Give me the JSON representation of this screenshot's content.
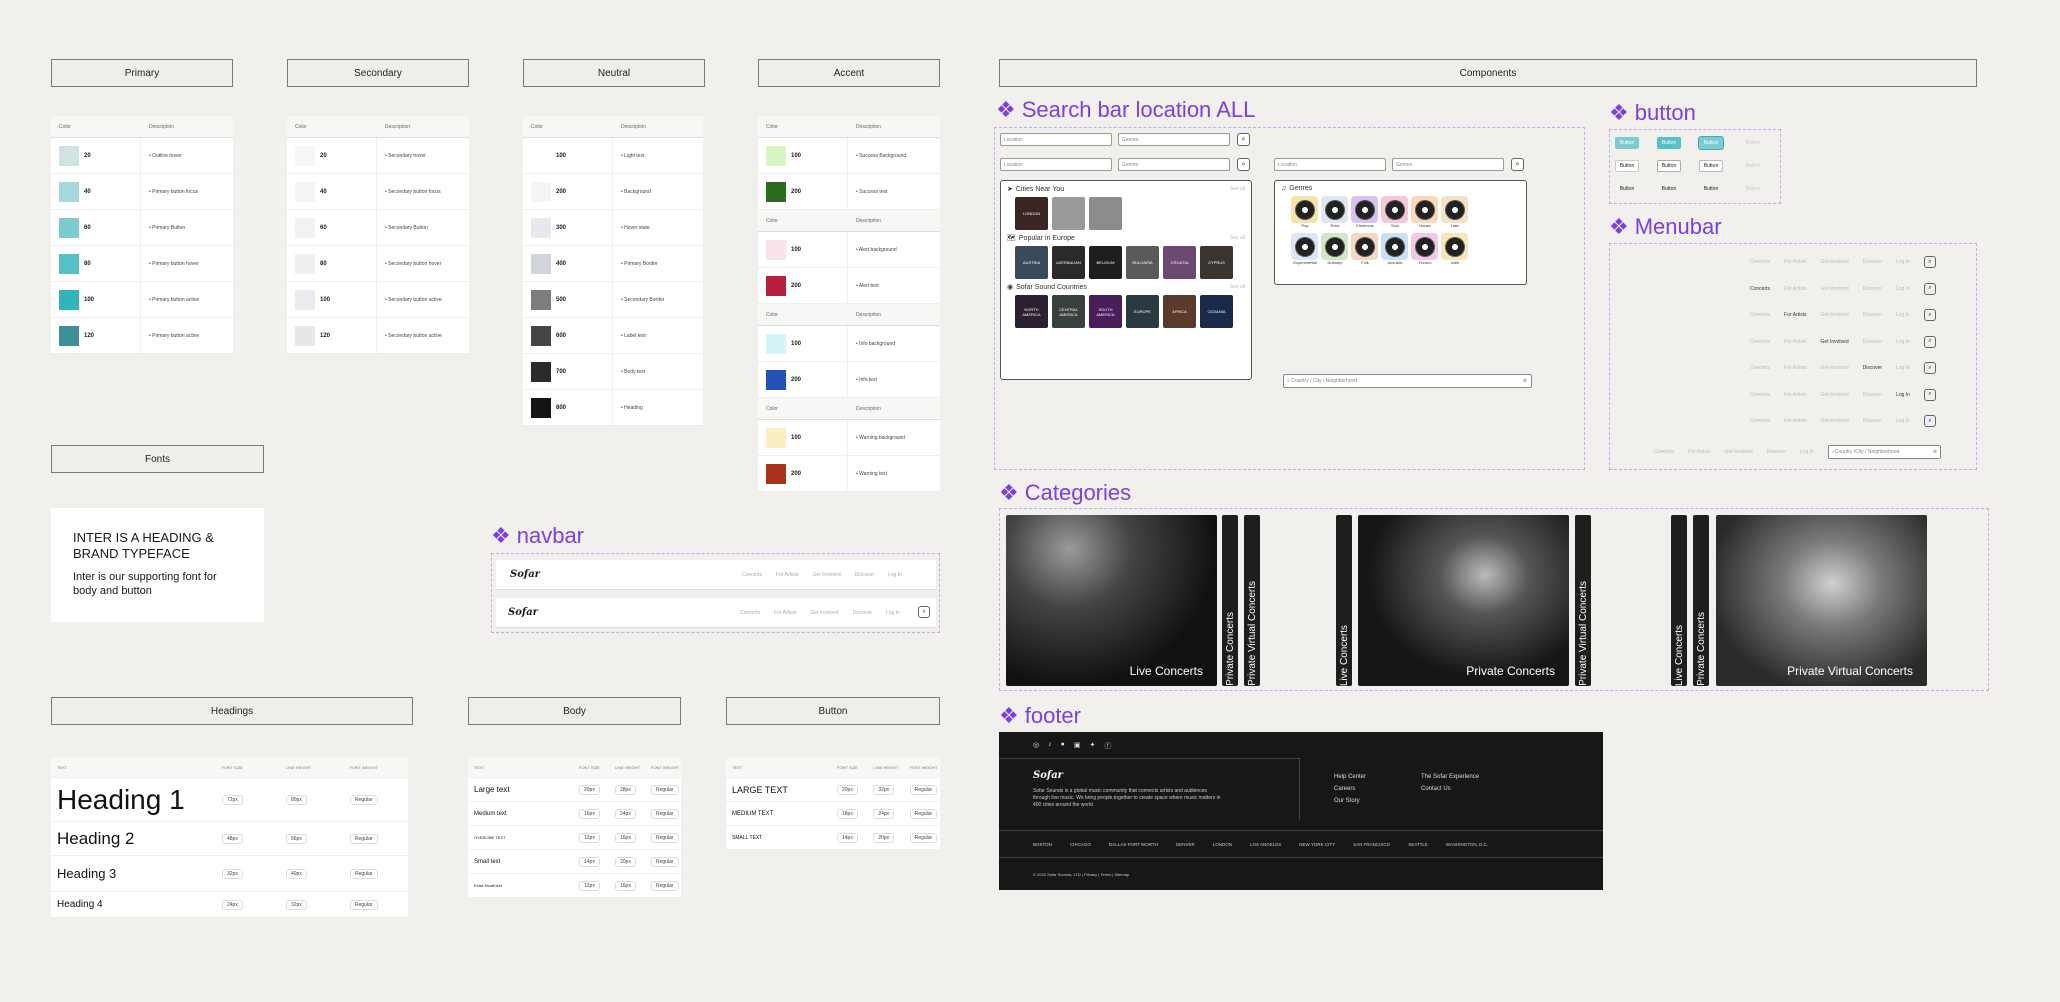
{
  "frames": {
    "primary": "Primary",
    "secondary": "Secondary",
    "neutral": "Neutral",
    "accent": "Accent",
    "components": "Components",
    "fonts": "Fonts",
    "headings": "Headings",
    "body": "Body",
    "button": "Button"
  },
  "table_header": {
    "color": "Color",
    "description": "Description"
  },
  "primary_rows": [
    {
      "w": "20",
      "d": "• Outline hover",
      "c": "#cfe3e3"
    },
    {
      "w": "40",
      "d": "• Primary button focus",
      "c": "#a6d9dc"
    },
    {
      "w": "60",
      "d": "• Primary Button",
      "c": "#7ccccf"
    },
    {
      "w": "80",
      "d": "• Primary button hover",
      "c": "#55c1c6"
    },
    {
      "w": "100",
      "d": "• Primary button active",
      "c": "#2fb4bb"
    },
    {
      "w": "120",
      "d": "• Primary button active",
      "c": "#3c8f96"
    }
  ],
  "secondary_rows": [
    {
      "w": "20",
      "d": "• Secondary hover",
      "c": "#f6f6f7"
    },
    {
      "w": "40",
      "d": "• Secondary button focus",
      "c": "#f4f4f6"
    },
    {
      "w": "60",
      "d": "• Secondary Button",
      "c": "#f2f2f4"
    },
    {
      "w": "80",
      "d": "• Secondary button hover",
      "c": "#efeff2"
    },
    {
      "w": "100",
      "d": "• Secondary button active",
      "c": "#ececf0"
    },
    {
      "w": "120",
      "d": "• Secondary button active",
      "c": "#e6e6eb"
    }
  ],
  "neutral_rows": [
    {
      "w": "100",
      "d": "• Light text",
      "c": "#ffffff"
    },
    {
      "w": "200",
      "d": "• Background",
      "c": "#f3f4f7"
    },
    {
      "w": "300",
      "d": "• Hover state",
      "c": "#e6e8ee"
    },
    {
      "w": "400",
      "d": "• Primary Border",
      "c": "#d2d4dc"
    },
    {
      "w": "500",
      "d": "• Secondary Border",
      "c": "#7d7d7d"
    },
    {
      "w": "600",
      "d": "• Label text",
      "c": "#444444"
    },
    {
      "w": "700",
      "d": "• Body text",
      "c": "#2b2b2b"
    },
    {
      "w": "800",
      "d": "• Heading",
      "c": "#141414"
    }
  ],
  "accent_groups": [
    [
      {
        "w": "100",
        "d": "• Success Background",
        "c": "#d8f5c3"
      },
      {
        "w": "200",
        "d": "• Success text",
        "c": "#2a6b1f"
      }
    ],
    [
      {
        "w": "100",
        "d": "• Alert background",
        "c": "#fbe3ee"
      },
      {
        "w": "200",
        "d": "• Alert text",
        "c": "#b5203c"
      }
    ],
    [
      {
        "w": "100",
        "d": "• Info background",
        "c": "#d6f3f7"
      },
      {
        "w": "200",
        "d": "• Info text",
        "c": "#2351b8"
      }
    ],
    [
      {
        "w": "100",
        "d": "• Warning background",
        "c": "#fbeec0"
      },
      {
        "w": "200",
        "d": "• Warning text",
        "c": "#a8341c"
      }
    ]
  ],
  "fonts_card": {
    "heading": "INTER IS A HEADING & BRAND TYPEFACE",
    "sub": "Inter is our supporting font for body and button"
  },
  "headings_table": {
    "cols": [
      "TEXT",
      "FONT SIZE",
      "LINE HEIGHT",
      "FONT WEIGHT"
    ],
    "rows": [
      {
        "t": "Heading 1",
        "s": "72px",
        "l": "80px",
        "w": "Regular"
      },
      {
        "t": "Heading 2",
        "s": "48px",
        "l": "56px",
        "w": "Regular"
      },
      {
        "t": "Heading 3",
        "s": "32px",
        "l": "40px",
        "w": "Regular"
      },
      {
        "t": "Heading 4",
        "s": "24px",
        "l": "32px",
        "w": "Regular"
      }
    ]
  },
  "body_table": {
    "cols": [
      "TEXT",
      "FONT SIZE",
      "LINE HEIGHT",
      "FONT WEIGHT"
    ],
    "rows": [
      {
        "t": "Large text",
        "s": "20px",
        "l": "28px",
        "w": "Regular"
      },
      {
        "t": "Medium text",
        "s": "16px",
        "l": "24px",
        "w": "Regular"
      },
      {
        "t": "OVERLINE TEXT",
        "s": "12px",
        "l": "16px",
        "w": "Regular"
      },
      {
        "t": "Small text",
        "s": "14px",
        "l": "20px",
        "w": "Regular"
      },
      {
        "t": "Extra Small text",
        "s": "12px",
        "l": "16px",
        "w": "Regular"
      }
    ]
  },
  "button_table": {
    "cols": [
      "TEXT",
      "FONT SIZE",
      "LINE HEIGHT",
      "FONT WEIGHT"
    ],
    "rows": [
      {
        "t": "LARGE TEXT",
        "s": "20px",
        "l": "32px",
        "w": "Regular"
      },
      {
        "t": "MEDIUM TEXT",
        "s": "18px",
        "l": "24px",
        "w": "Regular"
      },
      {
        "t": "SMALL TEXT",
        "s": "14px",
        "l": "20px",
        "w": "Regular"
      }
    ]
  },
  "navbar": {
    "title": "navbar",
    "logo": "Sofar",
    "links": [
      "Concerts",
      "For Artists",
      "Get Involved",
      "Discover",
      "Log In"
    ]
  },
  "search": {
    "title": "Search bar location ALL",
    "location": "Location",
    "genres": "Genres",
    "cities_near": "Cities Near You",
    "see_all": "See all",
    "city_tiles": [
      "LONDON",
      "",
      ""
    ],
    "popular": "Popular in Europe",
    "europe": [
      "AUSTRIA",
      "AZERBAIJAN",
      "BELGIUM",
      "BULGARIA",
      "CROATIA",
      "CYPRUS"
    ],
    "sofar_countries": "Sofar Sound Countries",
    "regions": [
      "NORTH AMERICA",
      "CENTRAL AMERICA",
      "SOUTH AMERICA",
      "EUROPE",
      "AFRICA",
      "OCEANIA"
    ],
    "genres_panel": "Genres",
    "genre_list": [
      "Pop",
      "Rock",
      "Electronic",
      "Soul",
      "House",
      "Latin",
      "Experimental",
      "Dubstep",
      "Folk",
      "Acoustic",
      "Techno",
      "Indie"
    ],
    "country_placeholder": "Country / City / Neighborhood"
  },
  "button_comp": {
    "title": "button",
    "label": "Button"
  },
  "menubar": {
    "title": "Menubar",
    "links": [
      "Concerts",
      "For Artists",
      "Get Involved",
      "Discover",
      "Log In"
    ],
    "placeholder": "Country /City / Neighborhood"
  },
  "categories": {
    "title": "Categories",
    "live": "Live Concerts",
    "private": "Private Concerts",
    "virtual": "Private Virtual Concerts"
  },
  "footer": {
    "title": "footer",
    "logo": "Sofar",
    "about": "Sofar Sounds is a global music community that connects artists and audiences through live music. We bring people together to create space where music matters in 400 cities around the world.",
    "links_a": [
      "Help Center",
      "Careers",
      "Our Story"
    ],
    "links_b": [
      "The Sofar Experience",
      "Contact Us"
    ],
    "cities": [
      "BOSTON",
      "CHICAGO",
      "DALLAS-FORT WORTH",
      "DENVER",
      "LONDON",
      "LOS ANGELES",
      "NEW YORK CITY",
      "SAN FRANCISCO",
      "SEATTLE",
      "WASHINGTON, D.C."
    ],
    "copyright": "© 2022 Sofar Sounds, LTD | Privacy | Terms | Sitemap"
  }
}
